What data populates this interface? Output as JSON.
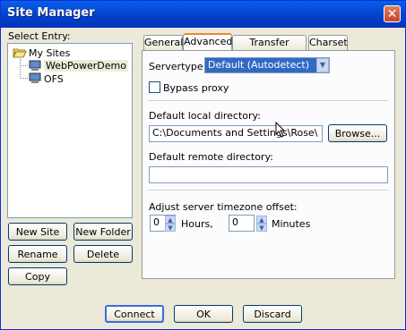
{
  "window": {
    "title": "Site Manager",
    "close_glyph": "✕"
  },
  "left": {
    "select_entry_label": "Select Entry:",
    "tree": [
      {
        "label": "My Sites",
        "icon": "folder-open-icon"
      },
      {
        "label": "WebPowerDemo",
        "icon": "computer-icon",
        "selected": true
      },
      {
        "label": "OFS",
        "icon": "computer-icon"
      }
    ],
    "buttons": {
      "new_site": "New Site",
      "new_folder": "New Folder",
      "rename": "Rename",
      "delete": "Delete",
      "copy": "Copy"
    }
  },
  "tabs": [
    "General",
    "Advanced",
    "Transfer settings",
    "Charset"
  ],
  "active_tab": "Advanced",
  "advanced": {
    "servertype_label": "Servertype:",
    "servertype_value": "Default (Autodetect)",
    "bypass_proxy_label": "Bypass proxy",
    "bypass_proxy_checked": false,
    "local_dir_label": "Default local directory:",
    "local_dir_value": "C:\\Documents and Settings\\Rose\\ Baldwin\\",
    "browse_label": "Browse...",
    "remote_dir_label": "Default remote directory:",
    "remote_dir_value": "",
    "timezone_label": "Adjust server timezone offset:",
    "hours_value": "0",
    "hours_label": "Hours,",
    "minutes_value": "0",
    "minutes_label": "Minutes"
  },
  "footer": {
    "connect": "Connect",
    "ok": "OK",
    "discard": "Discard"
  },
  "colors": {
    "titlebar": "#0346d1",
    "selection": "#316ac5",
    "dialog_bg": "#ece9d8"
  }
}
